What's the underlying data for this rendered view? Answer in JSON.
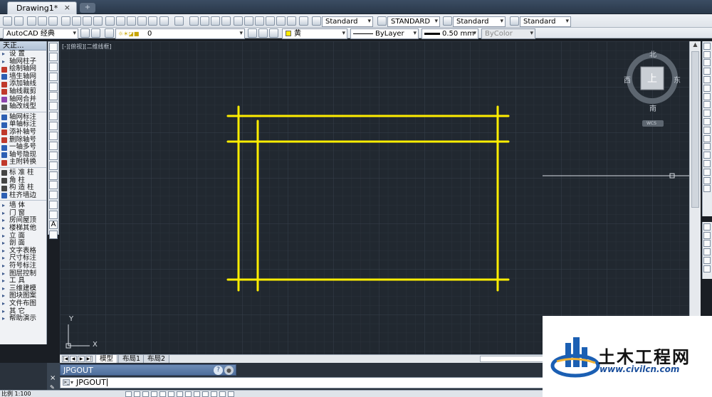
{
  "window": {
    "tab_title": "Drawing1*",
    "tab_close": "×",
    "new_tab": "+"
  },
  "toolbar1": {
    "text_style": "Standard",
    "dim_style": "STANDARD",
    "table_style": "Standard",
    "mleader_style": "Standard"
  },
  "toolbar2": {
    "workspace": "AutoCAD 经典",
    "layer": "0",
    "color": "黄",
    "linetype": "ByLayer",
    "lineweight": "0.50 mm",
    "plotstyle": "ByColor"
  },
  "palette": {
    "title": "天正...",
    "groups": [
      {
        "kind": "tri",
        "label": "设    置"
      },
      {
        "kind": "tri",
        "label": "轴网柱子"
      },
      {
        "kind": "icon",
        "color": "#c0392b",
        "label": "绘制轴网"
      },
      {
        "kind": "icon",
        "color": "#2d5fb3",
        "label": "墙生轴网"
      },
      {
        "kind": "icon",
        "color": "#c0392b",
        "label": "添加轴线"
      },
      {
        "kind": "icon",
        "color": "#c0392b",
        "label": "轴线裁剪"
      },
      {
        "kind": "icon",
        "color": "#8e44ad",
        "label": "轴网合并"
      },
      {
        "kind": "icon",
        "color": "#555555",
        "label": "轴改线型"
      },
      {
        "kind": "sep"
      },
      {
        "kind": "icon",
        "color": "#2d5fb3",
        "label": "轴网标注"
      },
      {
        "kind": "icon",
        "color": "#2d5fb3",
        "label": "单轴标注"
      },
      {
        "kind": "icon",
        "color": "#c0392b",
        "label": "添补轴号"
      },
      {
        "kind": "icon",
        "color": "#c0392b",
        "label": "删除轴号"
      },
      {
        "kind": "icon",
        "color": "#2d5fb3",
        "label": "一轴多号"
      },
      {
        "kind": "icon",
        "color": "#2d5fb3",
        "label": "轴号隐现"
      },
      {
        "kind": "icon",
        "color": "#c0392b",
        "label": "主附转换"
      },
      {
        "kind": "sep"
      },
      {
        "kind": "icon",
        "color": "#444444",
        "label": "标 准 柱"
      },
      {
        "kind": "icon",
        "color": "#444444",
        "label": "角    柱"
      },
      {
        "kind": "icon",
        "color": "#444444",
        "label": "构 造 柱"
      },
      {
        "kind": "icon",
        "color": "#2d5fb3",
        "label": "柱齐墙边"
      },
      {
        "kind": "sep"
      },
      {
        "kind": "tri",
        "label": "墙    体"
      },
      {
        "kind": "tri",
        "label": "门    窗"
      },
      {
        "kind": "tri",
        "label": "房间屋顶"
      },
      {
        "kind": "tri",
        "label": "楼梯其他"
      },
      {
        "kind": "tri",
        "label": "立    面"
      },
      {
        "kind": "tri",
        "label": "剖    面"
      },
      {
        "kind": "tri",
        "label": "文字表格"
      },
      {
        "kind": "tri",
        "label": "尺寸标注"
      },
      {
        "kind": "tri",
        "label": "符号标注"
      },
      {
        "kind": "tri",
        "label": "图层控制"
      },
      {
        "kind": "tri",
        "label": "工    具"
      },
      {
        "kind": "tri",
        "label": "三维建模"
      },
      {
        "kind": "tri",
        "label": "图块图案"
      },
      {
        "kind": "tri",
        "label": "文件布图"
      },
      {
        "kind": "tri",
        "label": "其    它"
      },
      {
        "kind": "tri",
        "label": "帮助演示"
      }
    ]
  },
  "viewport": {
    "label": "[-][俯视][二维线框]",
    "background": "#212830",
    "line_color": "#ffee00",
    "ucs_x": "X",
    "ucs_y": "Y"
  },
  "viewcube": {
    "north": "北",
    "south": "南",
    "east": "东",
    "west": "西",
    "top_face": "上",
    "wcs": "WCS"
  },
  "layout_tabs": [
    {
      "label": "模型",
      "active": true
    },
    {
      "label": "布局1",
      "active": false
    },
    {
      "label": "布局2",
      "active": false
    }
  ],
  "command": {
    "history": "JPGOUT",
    "input": "JPGOUT",
    "help": "?",
    "close": "×"
  },
  "status": {
    "scale": "比例 1:100"
  },
  "watermark": {
    "brand": "土木工程网",
    "url": "www.civilcn.com"
  }
}
